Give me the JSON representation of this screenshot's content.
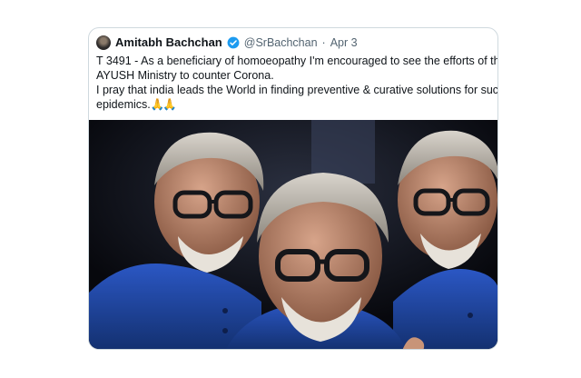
{
  "tweet": {
    "author_name": "Amitabh Bachchan",
    "verified_icon": "verified-badge-icon",
    "handle": "@SrBachchan",
    "separator": "·",
    "date": "Apr 3",
    "text_line_1": "T 3491 - As a beneficiary of homoeopathy I'm encouraged to see the efforts of the",
    "text_line_2": "AYUSH Ministry to counter Corona.",
    "text_line_3": "I pray that india leads the World in finding preventive & curative solutions for such",
    "text_line_4": "epidemics.",
    "emoji": "🙏🙏",
    "media": {
      "description_icon": "photo-collage-image",
      "accent_colors": {
        "jacket_blue": "#1f46a8",
        "background_dark": "#0d0f16",
        "verified_blue": "#1d9bf0"
      }
    }
  }
}
